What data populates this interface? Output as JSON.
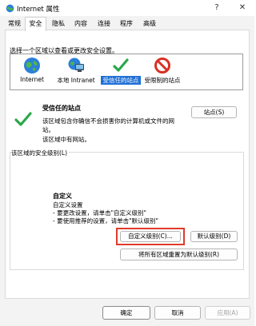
{
  "window": {
    "title": "Internet 属性"
  },
  "title_buttons": {
    "help": "?",
    "close": "✕"
  },
  "tabs": [
    "常规",
    "安全",
    "隐私",
    "内容",
    "连接",
    "程序",
    "高级"
  ],
  "instruction": "选择一个区域以查看或更改安全设置。",
  "zones": [
    {
      "label": "Internet",
      "icon": "globe-icon"
    },
    {
      "label": "本地 Intranet",
      "icon": "intranet-icon"
    },
    {
      "label": "受信任的站点",
      "icon": "checkmark-icon",
      "selected": true
    },
    {
      "label": "受限制的站点",
      "icon": "restricted-icon"
    }
  ],
  "selected_zone": {
    "title": "受信任的站点",
    "description": "该区域包含你确信不会损害你的计算机或文件的网站。",
    "note": "该区域中有网站。",
    "sites_button": "站点(S)"
  },
  "security_level": {
    "group_label": "该区域的安全级别(L)",
    "level_name": "自定义",
    "lines": [
      "自定义设置",
      "- 要更改设置，请单击\"自定义级别\"",
      "- 要使用推荐的设置，请单击\"默认级别\""
    ],
    "custom_button": "自定义级别(C)...",
    "default_button": "默认级别(D)",
    "reset_all_button": "将所有区域重置为默认级别(R)"
  },
  "footer": {
    "ok": "确定",
    "cancel": "取消",
    "apply": "应用(A)"
  },
  "colors": {
    "selection": "#1f6fd6",
    "highlight": "#e03a2a",
    "check": "#2aa84a",
    "restricted": "#d93025"
  }
}
